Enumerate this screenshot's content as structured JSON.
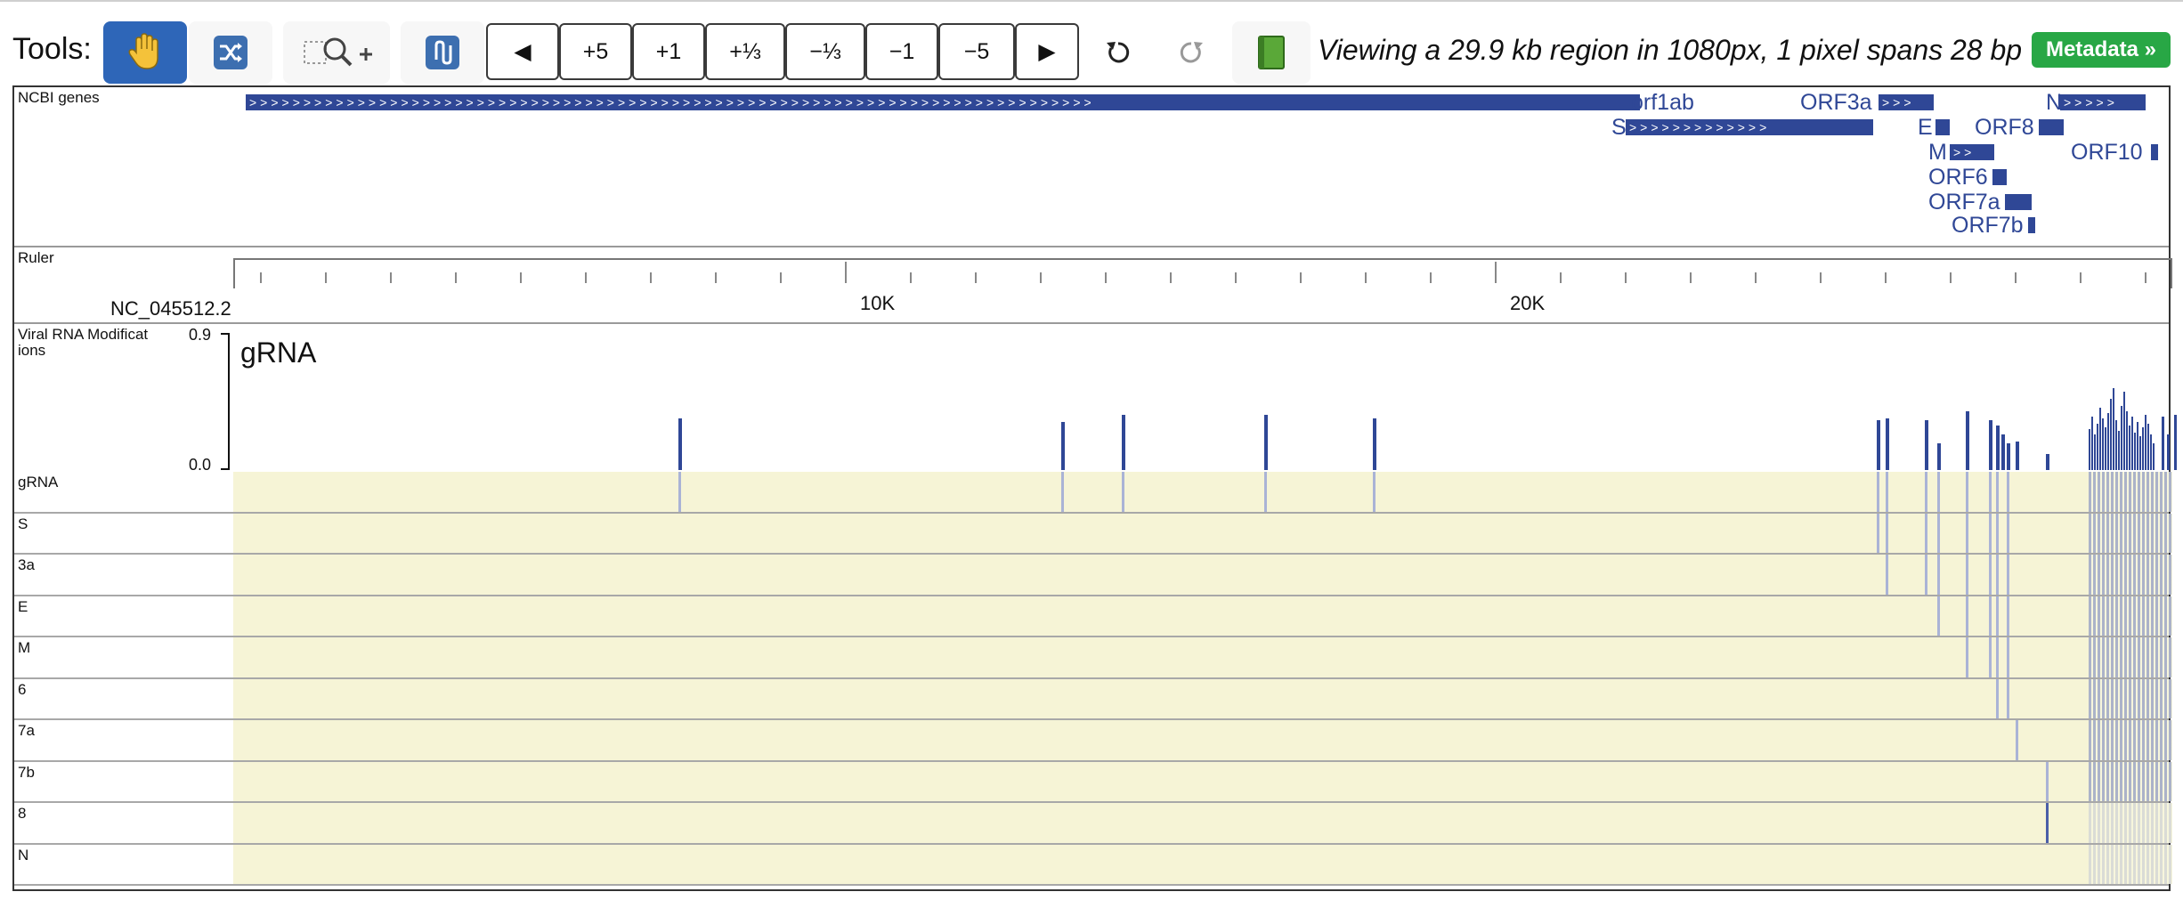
{
  "toolbar": {
    "tools_label": "Tools:",
    "nav_buttons": [
      "◀",
      "+5",
      "+1",
      "+⅓",
      "−⅓",
      "−1",
      "−5",
      "▶"
    ],
    "status": "Viewing a 29.9 kb region in 1080px, 1 pixel spans 28 bp",
    "metadata_label": "Metadata »"
  },
  "colors": {
    "gene": "#2f4796",
    "lane_bg": "#f6f4d6",
    "active_tool": "#2e66b8",
    "metadata": "#28a745"
  },
  "tracks": {
    "genes_label": "NCBI genes",
    "ruler_label": "Ruler",
    "accession": "NC_045512.2",
    "ruler_ticks": [
      "10K",
      "20K"
    ],
    "mod_label_line1": "Viral RNA Modificat",
    "mod_label_line2": "ions",
    "mod_y_max": "0.9",
    "mod_y_min": "0.0",
    "mod_title": "gRNA"
  },
  "genes": [
    "orf1ab",
    "ORF3a",
    "N",
    "S",
    "E",
    "ORF8",
    "M",
    "ORF10",
    "ORF6",
    "ORF7a",
    "ORF7b"
  ],
  "lanes": [
    "gRNA",
    "S",
    "3a",
    "E",
    "M",
    "6",
    "7a",
    "7b",
    "8",
    "N"
  ]
}
